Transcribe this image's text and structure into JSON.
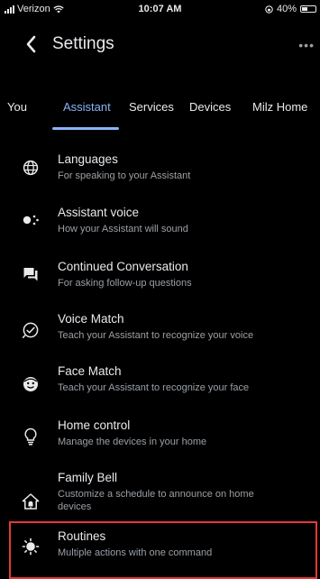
{
  "status_bar": {
    "carrier": "Verizon",
    "time": "10:07 AM",
    "battery": "40%"
  },
  "header": {
    "title": "Settings"
  },
  "tabs": [
    {
      "label": "You"
    },
    {
      "label": "Assistant"
    },
    {
      "label": "Services"
    },
    {
      "label": "Devices"
    },
    {
      "label": "Milz Home"
    }
  ],
  "items": [
    {
      "title": "Languages",
      "subtitle": "For speaking to your Assistant",
      "icon": "globe-icon"
    },
    {
      "title": "Assistant voice",
      "subtitle": "How your Assistant will sound",
      "icon": "voice-icon"
    },
    {
      "title": "Continued Conversation",
      "subtitle": "For asking follow-up questions",
      "icon": "chat-icon"
    },
    {
      "title": "Voice Match",
      "subtitle": "Teach your Assistant to recognize your voice",
      "icon": "voice-match-icon"
    },
    {
      "title": "Face Match",
      "subtitle": "Teach your Assistant to recognize your face",
      "icon": "face-icon"
    },
    {
      "title": "Home control",
      "subtitle": "Manage the devices in your home",
      "icon": "lightbulb-icon"
    },
    {
      "title": "Family Bell",
      "subtitle": "Customize a schedule to announce on home devices",
      "icon": "home-bell-icon"
    },
    {
      "title": "Routines",
      "subtitle": "Multiple actions with one command",
      "icon": "routines-icon"
    }
  ],
  "colors": {
    "background": "#000000",
    "accent": "#8ab4f8",
    "highlight": "#e53935",
    "text": "#e8eaed",
    "subtext": "#9aa0a6"
  }
}
